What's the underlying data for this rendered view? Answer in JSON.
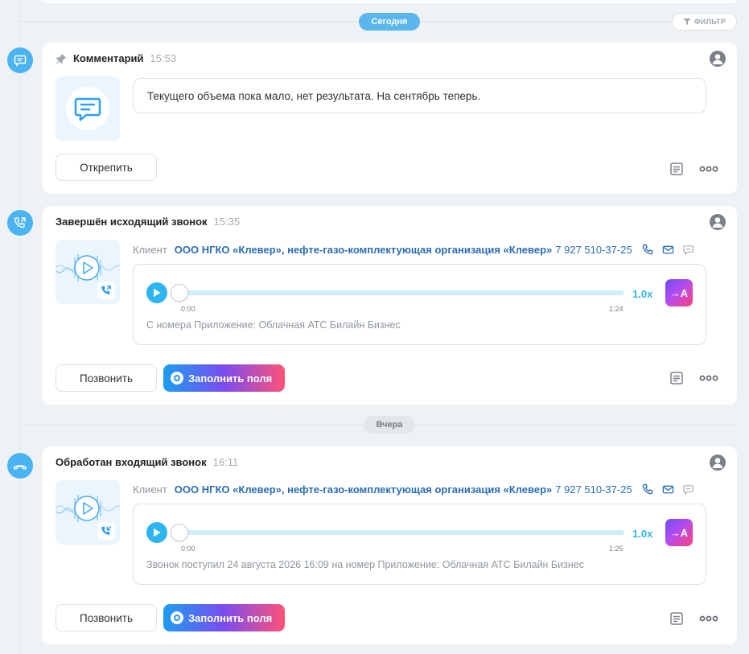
{
  "dates": {
    "today": "Сегодня",
    "yesterday": "Вчера"
  },
  "filter": {
    "label": "ФИЛЬТР",
    "icon": "filter-icon"
  },
  "comment_card": {
    "title": "Комментарий",
    "time": "15:53",
    "text": "Текущего объема пока мало, нет результата. На сентябрь теперь.",
    "unpin_label": "Открепить",
    "icons": [
      "pin-icon",
      "comment-icon",
      "user-icon",
      "note-icon",
      "more-icon"
    ]
  },
  "call_cards": [
    {
      "title": "Завершён исходящий звонок",
      "time": "15:35",
      "direction": "outgoing",
      "client_label": "Клиент",
      "client_name": "ООО НГКО «Клевер», нефте-газо-комплектующая организация «Клевер»",
      "client_phone": "7 927 510-37-25",
      "player": {
        "start": "0:00",
        "end": "1:24",
        "speed": "1.0x",
        "transcribe_label": "→A",
        "progress": 0
      },
      "note": "С номера Приложение: Облачная АТС Билайн Бизнес",
      "call_label": "Позвонить",
      "fill_label": "Заполнить поля"
    },
    {
      "title": "Обработан входящий звонок",
      "time": "16:11",
      "direction": "incoming",
      "client_label": "Клиент",
      "client_name": "ООО НГКО «Клевер», нефте-газо-комплектующая организация «Клевер»",
      "client_phone": "7 927 510-37-25",
      "player": {
        "start": "0:00",
        "end": "1:25",
        "speed": "1.0x",
        "transcribe_label": "→A",
        "progress": 0
      },
      "note": "Звонок поступил 24 августа 2026 16:09 на номер Приложение: Облачная АТС Билайн Бизнес",
      "call_label": "Позвонить",
      "fill_label": "Заполнить поля"
    }
  ],
  "colors": {
    "accent": "#4ab3f2",
    "link": "#2a6cb5",
    "play": "#2cb5ef",
    "background": "#eef2f4"
  }
}
